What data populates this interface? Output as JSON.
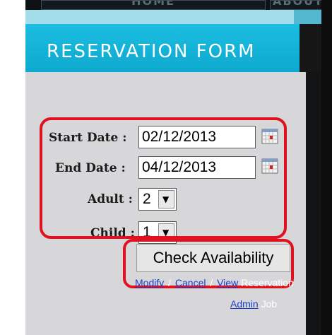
{
  "nav": {
    "tabs": [
      {
        "label": "HOME"
      },
      {
        "label": "ABOUT"
      }
    ]
  },
  "form": {
    "title": "RESERVATION FORM",
    "fields": {
      "start_date": {
        "label": "Start Date :",
        "value": "02/12/2013",
        "icon": "calendar-icon"
      },
      "end_date": {
        "label": "End Date :",
        "value": "04/12/2013",
        "icon": "calendar-icon"
      },
      "adult": {
        "label": "Adult :",
        "value": "2"
      },
      "child": {
        "label": "Child :",
        "value": "1"
      }
    },
    "check_button_label": "Check Availability"
  },
  "links": {
    "modify": "Modify",
    "sep1": "/",
    "cancel": "Cancel",
    "sep2": "/",
    "view": "View",
    "reservation": "Reservation",
    "admin": "Admin",
    "job": "Job"
  },
  "colors": {
    "banner": "#15b5dc",
    "panel": "#d7d7d9",
    "highlight": "#e0121f",
    "link": "#1a3cc7"
  }
}
